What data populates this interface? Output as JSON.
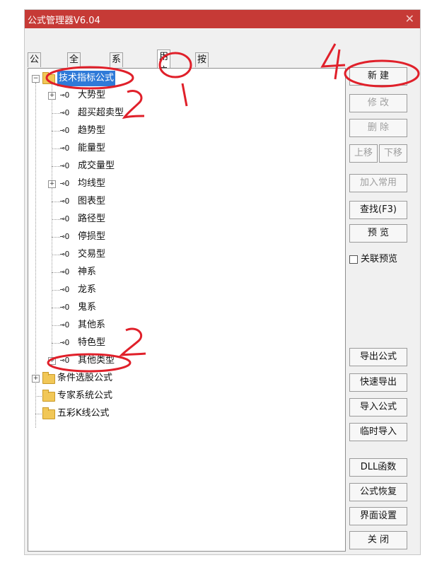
{
  "window": {
    "title": "公式管理器V6.04",
    "close_glyph": "✕"
  },
  "tabs": [
    "公式组",
    "全部",
    "系统",
    "用户",
    "按日期频度"
  ],
  "tree": {
    "root_expanded": "技术指标公式",
    "items": [
      "大势型",
      "超买超卖型",
      "趋势型",
      "能量型",
      "成交量型",
      "均线型",
      "图表型",
      "路径型",
      "停损型",
      "交易型",
      "神系",
      "龙系",
      "鬼系",
      "其他系",
      "特色型",
      "其他类型"
    ],
    "other_roots": [
      "条件选股公式",
      "专家系统公式",
      "五彩K线公式"
    ],
    "expander_plus": "+",
    "expander_minus": "−",
    "key_glyph": "⊸O"
  },
  "buttons": {
    "new": "新 建",
    "edit": "修 改",
    "delete": "删 除",
    "move_up": "上移",
    "move_down": "下移",
    "add_common": "加入常用",
    "find": "查找(F3)",
    "preview": "预 览",
    "link_preview": "关联预览",
    "export": "导出公式",
    "quick_export": "快速导出",
    "import": "导入公式",
    "temp_import": "临时导入",
    "dll": "DLL函数",
    "restore": "公式恢复",
    "ui_settings": "界面设置",
    "close": "关 闭"
  },
  "annotations": {
    "n1": "1",
    "n2": "2",
    "n3": "2",
    "n4": "4",
    "color": "#e0202a"
  }
}
